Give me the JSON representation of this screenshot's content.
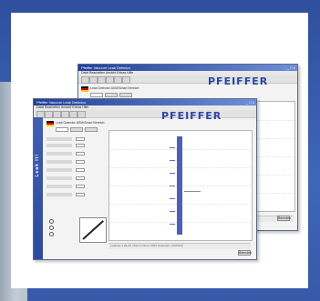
{
  "background": {
    "frame_color": "#3a5aa8",
    "card_color": "#ffffff"
  },
  "back_window": {
    "title": "Pfeiffer Vacuum Leak Detector",
    "menu": "Datei  Bearbeiten  Ansicht  Extras  Hilfe",
    "brand": "PFEIFFER",
    "status_text": "Leak Detector  ASM/Smart  Bereich:  ",
    "language_flag": "de-flag",
    "bottom_button": "Beenden",
    "bottom_text": "MSM Evaluation (SOPHIA)"
  },
  "front_window": {
    "title": "Pfeiffer Vacuum Leak Detector",
    "menu": "Datei  Bearbeiten  Ansicht  Extras  Hilfe",
    "brand": "PFEIFFER",
    "status_text": "Leak Detector  ASM/Smart  Bereich:  ",
    "language_flag": "de-flag",
    "sidebar_text": "Leak It!",
    "bottom_button": "Beenden",
    "footer_text": "Leakrate    1.0E-09 mbar l/s      Druck   MSM Evaluation (SOPHIA)"
  },
  "icons": {
    "minimize": "minimize-icon",
    "maximize": "maximize-icon",
    "close": "close-icon"
  }
}
